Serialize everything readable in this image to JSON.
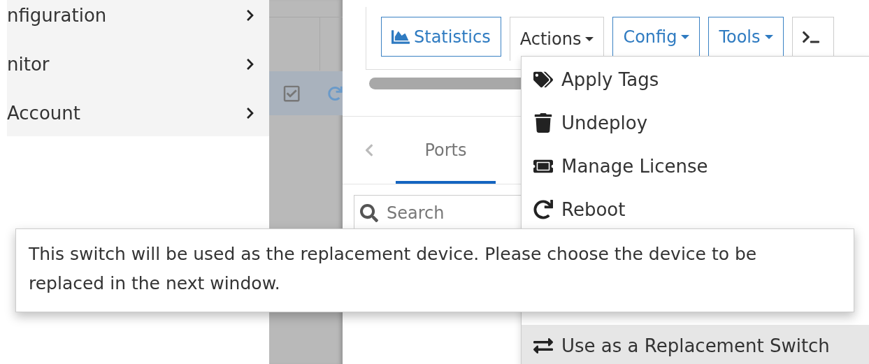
{
  "sidebar": {
    "items": [
      {
        "label": "nfiguration"
      },
      {
        "label": "nitor"
      },
      {
        "label": "Account"
      }
    ]
  },
  "table": {
    "rows": [
      {
        "selected": true,
        "checked": true
      }
    ]
  },
  "toolbar": {
    "buttons": [
      {
        "kind": "statistics",
        "label": "Statistics",
        "open": false
      },
      {
        "kind": "dropdown",
        "label": "Actions",
        "open": true
      },
      {
        "kind": "dropdown",
        "label": "Config",
        "open": false
      },
      {
        "kind": "dropdown",
        "label": "Tools",
        "open": false
      },
      {
        "kind": "terminal",
        "open": false
      }
    ]
  },
  "tabs": [
    {
      "label": "Ports",
      "selected": true
    }
  ],
  "search": {
    "placeholder": "Search"
  },
  "actions_menu": {
    "items": [
      {
        "label": "Apply Tags",
        "highlighted": false
      },
      {
        "label": "Undeploy",
        "highlighted": false
      },
      {
        "label": "Manage License",
        "highlighted": false
      },
      {
        "label": "Reboot",
        "highlighted": false
      },
      {
        "label": "Use as a Replacement Switch",
        "highlighted": true
      }
    ]
  },
  "tooltip": {
    "text": "This switch will be used as the replacement device. Please choose the device to be replaced in the next window."
  }
}
